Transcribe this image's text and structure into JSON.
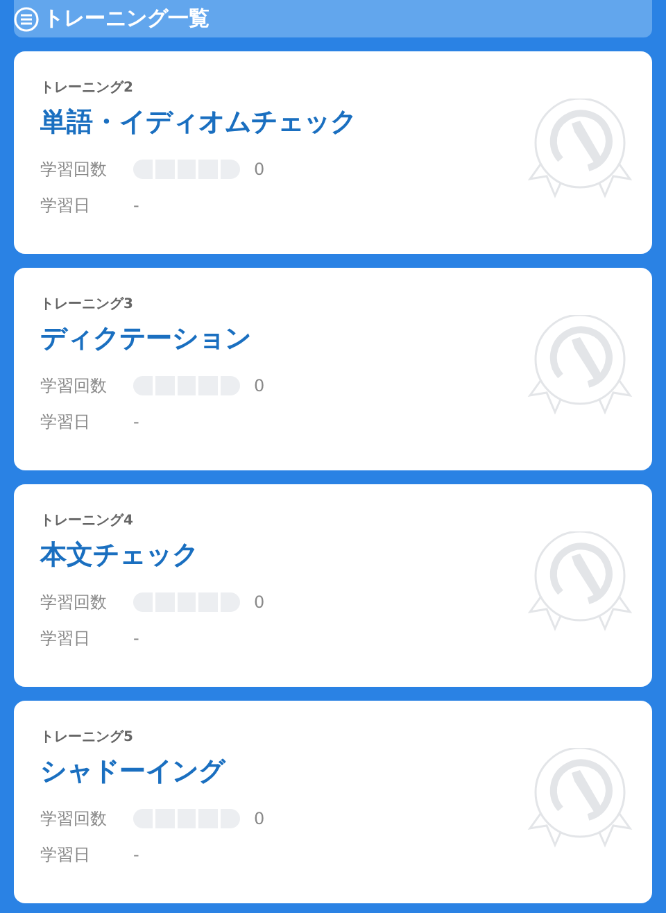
{
  "header": {
    "title": "トレーニング一覧"
  },
  "trainings": [
    {
      "label": "トレーニング2",
      "title": "単語・イディオムチェック",
      "count_label": "学習回数",
      "level": 0,
      "count": "0",
      "date_label": "学習日",
      "date": "-"
    },
    {
      "label": "トレーニング3",
      "title": "ディクテーション",
      "count_label": "学習回数",
      "level": 0,
      "count": "0",
      "date_label": "学習日",
      "date": "-"
    },
    {
      "label": "トレーニング4",
      "title": "本文チェック",
      "count_label": "学習回数",
      "level": 0,
      "count": "0",
      "date_label": "学習日",
      "date": "-"
    },
    {
      "label": "トレーニング5",
      "title": "シャドーイング",
      "count_label": "学習回数",
      "level": 0,
      "count": "0",
      "date_label": "学習日",
      "date": "-"
    }
  ]
}
